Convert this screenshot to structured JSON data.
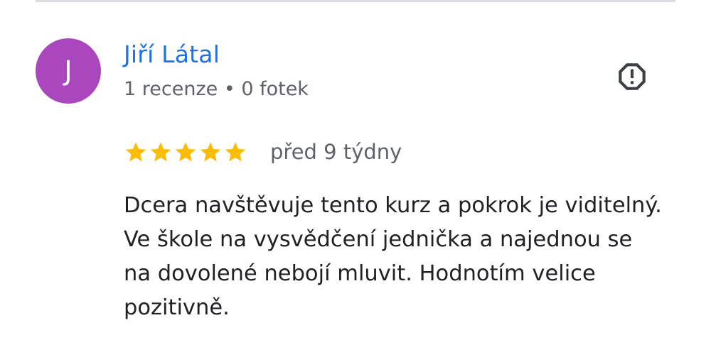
{
  "review": {
    "avatar_initial": "J",
    "avatar_color": "#ab47bc",
    "author_name": "Jiří Látal",
    "author_meta": "1 recenze • 0 fotek",
    "report_icon": "report-flag-icon",
    "rating": 5,
    "rating_max": 5,
    "star_color": "#fbbc04",
    "date": "před 9 týdny",
    "text": "Dcera navštěvuje tento kurz a pokrok je viditelný. Ve škole na vysvědčení jednička a najednou se na dovolené nebojí mluvit. Hodnotím velice pozitivně."
  },
  "colors": {
    "accent": "#1a73e8",
    "secondary_text": "#5f6368",
    "primary_text": "#202124",
    "divider": "#dadce0"
  }
}
